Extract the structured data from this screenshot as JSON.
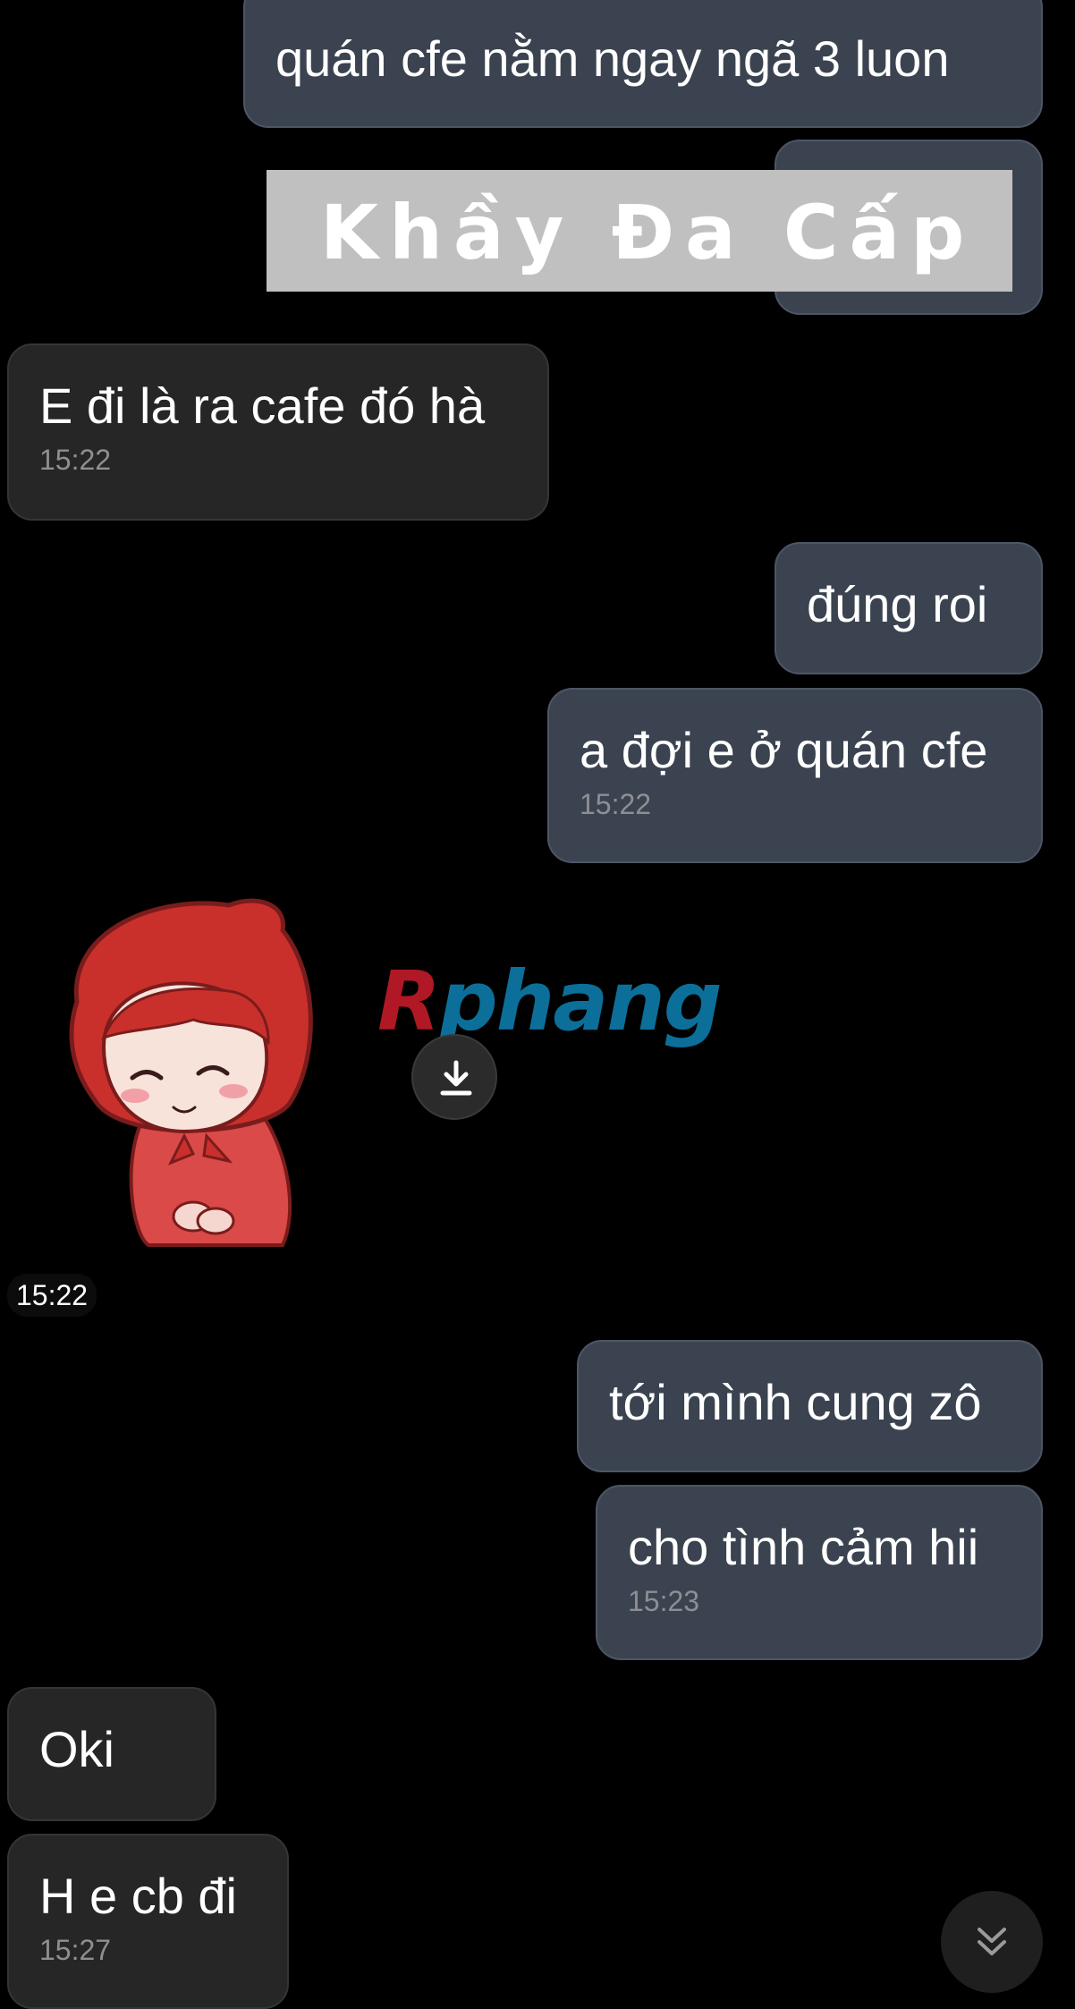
{
  "messages": [
    {
      "direction": "outgoing",
      "text": "quán cfe nằm ngay ngã 3 luon",
      "time": ""
    },
    {
      "direction": "outgoing",
      "text": "",
      "time": ""
    },
    {
      "direction": "incoming",
      "text": "E đi là ra cafe đó hà",
      "time": "15:22"
    },
    {
      "direction": "outgoing",
      "text": "đúng roi",
      "time": ""
    },
    {
      "direction": "outgoing",
      "text": "a đợi e ở quán cfe",
      "time": "15:22"
    },
    {
      "direction": "outgoing",
      "text": "tới mình cung zô",
      "time": ""
    },
    {
      "direction": "outgoing",
      "text": "cho tình cảm hii",
      "time": "15:23"
    },
    {
      "direction": "incoming",
      "text": "Oki",
      "time": ""
    },
    {
      "direction": "incoming",
      "text": "H e cb đi",
      "time": "15:27"
    }
  ],
  "watermark": {
    "text": "Khầy Đa Cấp"
  },
  "sticker": {
    "description_icon": "red-hood-girl-sticker-icon",
    "time": "15:22",
    "brand_first_letter": "R",
    "brand_rest": "phang",
    "download_icon": "download-icon"
  },
  "scroll_button": {
    "icon": "double-chevron-down-icon"
  },
  "colors": {
    "background": "#000000",
    "outgoing_bubble": "#3b4350",
    "incoming_bubble": "#262626",
    "time_text": "#8d8f93",
    "brand_red": "#b01825",
    "brand_blue": "#0b6f9a"
  }
}
